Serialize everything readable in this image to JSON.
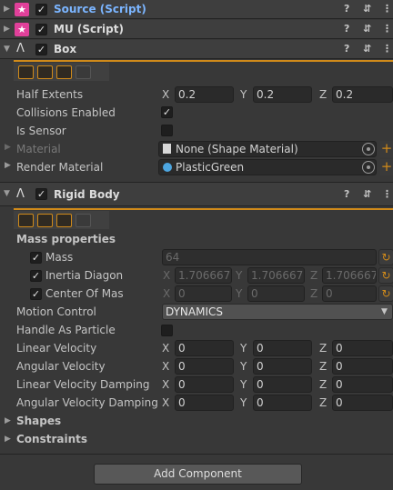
{
  "components": {
    "source_script": {
      "title": "Source (Script)"
    },
    "mu_script": {
      "title": "MU (Script)"
    },
    "box": {
      "title": "Box",
      "half_extents": {
        "label": "Half Extents",
        "x": "0.2",
        "y": "0.2",
        "z": "0.2"
      },
      "collisions_enabled": {
        "label": "Collisions Enabled",
        "checked": true
      },
      "is_sensor": {
        "label": "Is Sensor",
        "checked": false
      },
      "material": {
        "label": "Material",
        "value": "None (Shape Material)"
      },
      "render_material": {
        "label": "Render Material",
        "value": "PlasticGreen"
      }
    },
    "rigid_body": {
      "title": "Rigid Body",
      "mass_properties_label": "Mass properties",
      "mass": {
        "label": "Mass",
        "value": "64"
      },
      "inertia": {
        "label": "Inertia Diagon",
        "x": "1.706667",
        "y": "1.706667",
        "z": "1.706667"
      },
      "center_of_mass": {
        "label": "Center Of Mas",
        "x": "0",
        "y": "0",
        "z": "0"
      },
      "motion_control": {
        "label": "Motion Control",
        "value": "DYNAMICS"
      },
      "handle_as_particle": {
        "label": "Handle As Particle"
      },
      "linear_velocity": {
        "label": "Linear Velocity",
        "x": "0",
        "y": "0",
        "z": "0"
      },
      "angular_velocity": {
        "label": "Angular Velocity",
        "x": "0",
        "y": "0",
        "z": "0"
      },
      "linear_velocity_damping": {
        "label": "Linear Velocity Damping",
        "x": "0",
        "y": "0",
        "z": "0"
      },
      "angular_velocity_damping": {
        "label": "Angular Velocity Damping",
        "x": "0",
        "y": "0",
        "z": "0"
      },
      "shapes_label": "Shapes",
      "constraints_label": "Constraints"
    }
  },
  "axes": {
    "x": "X",
    "y": "Y",
    "z": "Z"
  },
  "header_icons": {
    "help": "?",
    "settings": "⇵",
    "menu": "⋮"
  },
  "add_component_label": "Add Component",
  "colors": {
    "accent": "#d08a1a",
    "script_icon": "#e0409a",
    "title_blue": "#7bb5ff"
  }
}
